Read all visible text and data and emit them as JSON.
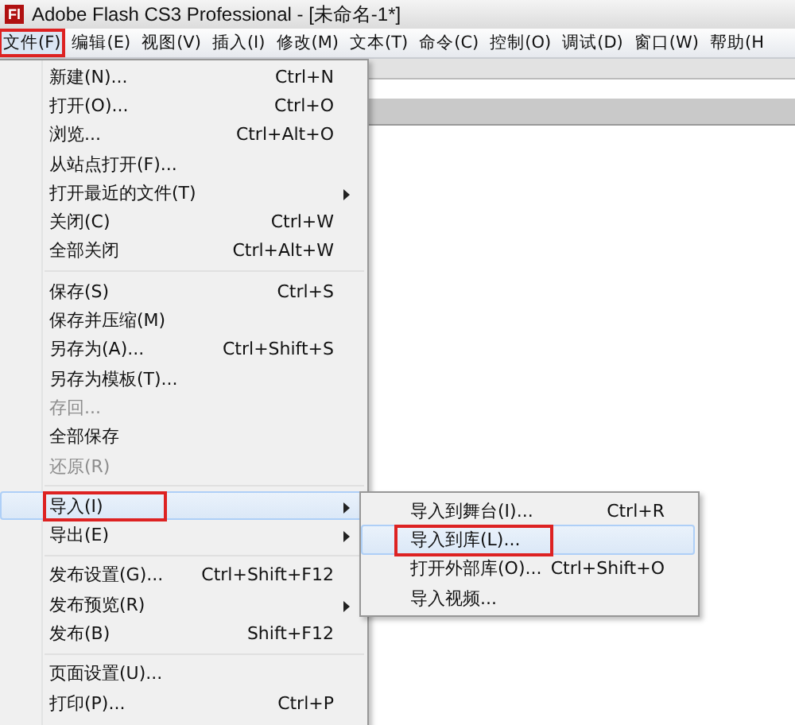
{
  "window": {
    "app_icon": "Fl",
    "title": "Adobe Flash CS3 Professional - [未命名-1*]"
  },
  "menubar": [
    {
      "label": "文件(F)",
      "selected": true,
      "annotated": true
    },
    {
      "label": "编辑(E)",
      "selected": false,
      "annotated": false
    },
    {
      "label": "视图(V)",
      "selected": false,
      "annotated": false
    },
    {
      "label": "插入(I)",
      "selected": false,
      "annotated": false
    },
    {
      "label": "修改(M)",
      "selected": false,
      "annotated": false
    },
    {
      "label": "文本(T)",
      "selected": false,
      "annotated": false
    },
    {
      "label": "命令(C)",
      "selected": false,
      "annotated": false
    },
    {
      "label": "控制(O)",
      "selected": false,
      "annotated": false
    },
    {
      "label": "调试(D)",
      "selected": false,
      "annotated": false
    },
    {
      "label": "窗口(W)",
      "selected": false,
      "annotated": false
    },
    {
      "label": "帮助(H",
      "selected": false,
      "annotated": false
    }
  ],
  "file_menu": [
    {
      "kind": "item",
      "label": "新建(N)...",
      "shortcut": "Ctrl+N",
      "disabled": false,
      "submenu": false,
      "selected": false,
      "annotated": false
    },
    {
      "kind": "item",
      "label": "打开(O)...",
      "shortcut": "Ctrl+O",
      "disabled": false,
      "submenu": false,
      "selected": false,
      "annotated": false
    },
    {
      "kind": "item",
      "label": "浏览...",
      "shortcut": "Ctrl+Alt+O",
      "disabled": false,
      "submenu": false,
      "selected": false,
      "annotated": false
    },
    {
      "kind": "item",
      "label": "从站点打开(F)...",
      "disabled": false,
      "submenu": false,
      "selected": false,
      "annotated": false
    },
    {
      "kind": "item",
      "label": "打开最近的文件(T)",
      "disabled": false,
      "submenu": true,
      "selected": false,
      "annotated": false
    },
    {
      "kind": "item",
      "label": "关闭(C)",
      "shortcut": "Ctrl+W",
      "disabled": false,
      "submenu": false,
      "selected": false,
      "annotated": false
    },
    {
      "kind": "item",
      "label": "全部关闭",
      "shortcut": "Ctrl+Alt+W",
      "disabled": false,
      "submenu": false,
      "selected": false,
      "annotated": false
    },
    {
      "kind": "separator"
    },
    {
      "kind": "item",
      "label": "保存(S)",
      "shortcut": "Ctrl+S",
      "disabled": false,
      "submenu": false,
      "selected": false,
      "annotated": false
    },
    {
      "kind": "item",
      "label": "保存并压缩(M)",
      "disabled": false,
      "submenu": false,
      "selected": false,
      "annotated": false
    },
    {
      "kind": "item",
      "label": "另存为(A)...",
      "shortcut": "Ctrl+Shift+S",
      "disabled": false,
      "submenu": false,
      "selected": false,
      "annotated": false
    },
    {
      "kind": "item",
      "label": "另存为模板(T)...",
      "disabled": false,
      "submenu": false,
      "selected": false,
      "annotated": false
    },
    {
      "kind": "item",
      "label": "存回...",
      "disabled": true,
      "submenu": false,
      "selected": false,
      "annotated": false
    },
    {
      "kind": "item",
      "label": "全部保存",
      "disabled": false,
      "submenu": false,
      "selected": false,
      "annotated": false
    },
    {
      "kind": "item",
      "label": "还原(R)",
      "disabled": true,
      "submenu": false,
      "selected": false,
      "annotated": false
    },
    {
      "kind": "separator"
    },
    {
      "kind": "item",
      "label": "导入(I)",
      "disabled": false,
      "submenu": true,
      "selected": true,
      "annotated": true
    },
    {
      "kind": "item",
      "label": "导出(E)",
      "disabled": false,
      "submenu": true,
      "selected": false,
      "annotated": false
    },
    {
      "kind": "separator"
    },
    {
      "kind": "item",
      "label": "发布设置(G)...",
      "shortcut": "Ctrl+Shift+F12",
      "disabled": false,
      "submenu": false,
      "selected": false,
      "annotated": false
    },
    {
      "kind": "item",
      "label": "发布预览(R)",
      "disabled": false,
      "submenu": true,
      "selected": false,
      "annotated": false
    },
    {
      "kind": "item",
      "label": "发布(B)",
      "shortcut": "Shift+F12",
      "disabled": false,
      "submenu": false,
      "selected": false,
      "annotated": false
    },
    {
      "kind": "separator"
    },
    {
      "kind": "item",
      "label": "页面设置(U)...",
      "disabled": false,
      "submenu": false,
      "selected": false,
      "annotated": false
    },
    {
      "kind": "item",
      "label": "打印(P)...",
      "shortcut": "Ctrl+P",
      "disabled": false,
      "submenu": false,
      "selected": false,
      "annotated": false
    }
  ],
  "import_submenu": [
    {
      "label": "导入到舞台(I)...",
      "shortcut": "Ctrl+R",
      "selected": false,
      "annotated": false
    },
    {
      "label": "导入到库(L)...",
      "selected": true,
      "annotated": true
    },
    {
      "label": "打开外部库(O)...",
      "shortcut": "Ctrl+Shift+O",
      "selected": false,
      "annotated": false
    },
    {
      "label": "导入视频...",
      "selected": false,
      "annotated": false
    }
  ]
}
